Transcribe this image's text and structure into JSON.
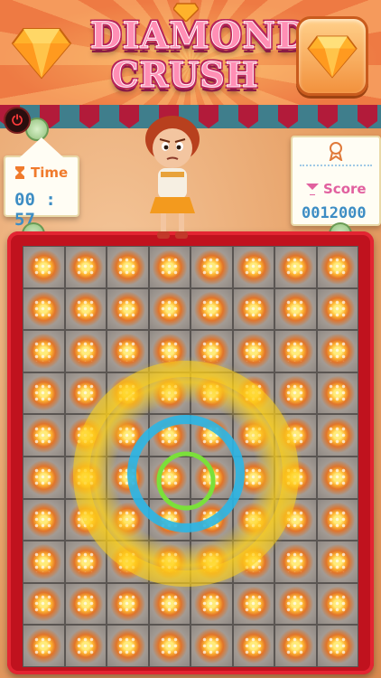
{
  "header": {
    "logo_line1": "DIAMOND",
    "logo_line2": "CRUSH",
    "gem_icon": "orange-diamond-icon",
    "colors": {
      "banner": "#ee7a43",
      "logo": "#ff8fb5",
      "logo_outline": "#b8245a"
    }
  },
  "hud": {
    "time_label": "Time",
    "time_value": "00 : 57",
    "score_label": "Score",
    "score_value": "0012000",
    "time_icon": "hourglass-icon",
    "score_icon": "cocktail-icon",
    "medal_icon": "ribbon-medal-icon",
    "power_icon": "power-icon"
  },
  "board": {
    "rows": 10,
    "cols": 8,
    "tile": "orange-star-gem",
    "frame_color": "#c0121e",
    "effect_rings": [
      {
        "color": "#ffd21a",
        "kind": "outer-glow"
      },
      {
        "color": "#2bb6e6",
        "kind": "middle"
      },
      {
        "color": "#7be03a",
        "kind": "inner"
      }
    ]
  }
}
